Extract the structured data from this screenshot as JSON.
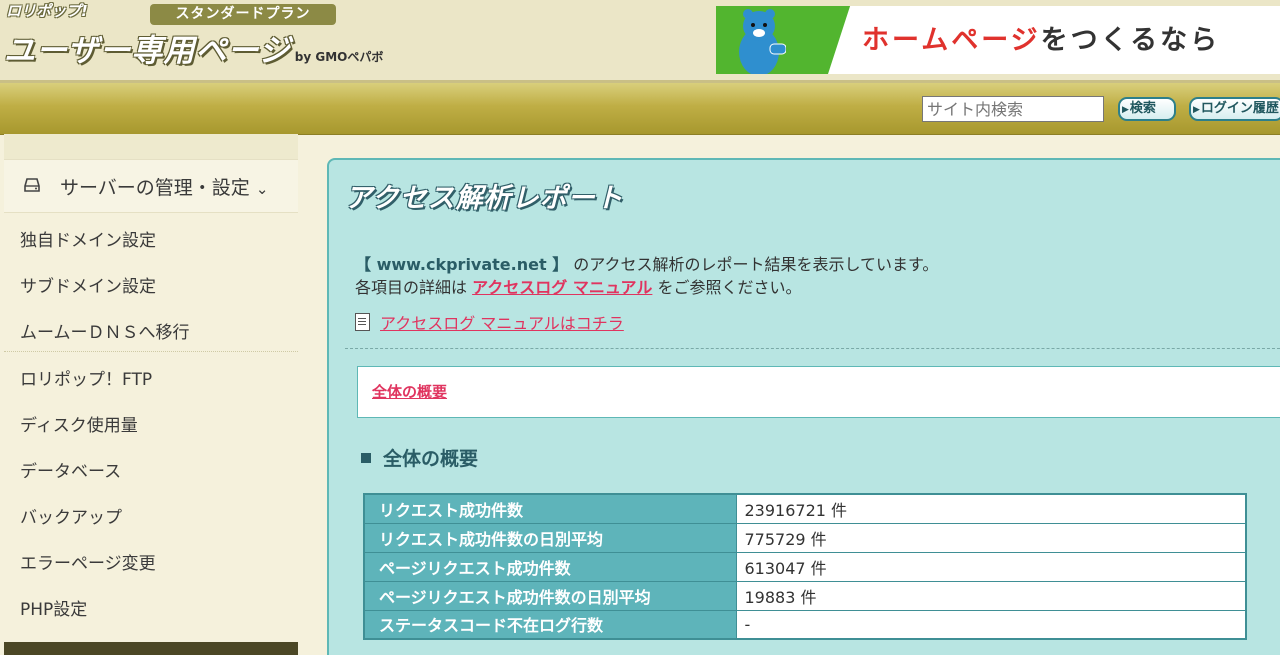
{
  "header": {
    "brand": "ロリポップ!",
    "plan": "スタンダードプラン",
    "title": "ユーザー専用ページ",
    "by": "by GMOペパボ",
    "banner": {
      "text_red1": "ホーム",
      "text_red2": "ページ",
      "text_dark": "をつくるなら"
    },
    "search": {
      "placeholder": "サイト内検索",
      "button": "検索"
    },
    "login_history": "ログイン履歴"
  },
  "sidebar": {
    "section": "サーバーの管理・設定",
    "items": [
      {
        "label": "独自ドメイン設定"
      },
      {
        "label": "サブドメイン設定"
      },
      {
        "label": "ムームーＤＮＳへ移行"
      },
      {
        "label": "ロリポップ！FTP"
      },
      {
        "label": "ディスク使用量"
      },
      {
        "label": "データベース"
      },
      {
        "label": "バックアップ"
      },
      {
        "label": "エラーページ変更"
      },
      {
        "label": "PHP設定"
      }
    ]
  },
  "main": {
    "title": "アクセス解析レポート",
    "intro": {
      "domain": "【 www.ckprivate.net 】",
      "line1_rest": " のアクセス解析のレポート結果を表示しています。",
      "line2_pre": "各項目の詳細は ",
      "line2_link": "アクセスログ マニュアル",
      "line2_post": " をご参照ください。"
    },
    "manual_link": "アクセスログ マニュアルはコチラ",
    "toc_link": "全体の概要",
    "section_heading": "全体の概要",
    "stats": [
      {
        "label": "リクエスト成功件数",
        "value": "23916721 件"
      },
      {
        "label": "リクエスト成功件数の日別平均",
        "value": "775729 件"
      },
      {
        "label": "ページリクエスト成功件数",
        "value": "613047 件"
      },
      {
        "label": "ページリクエスト成功件数の日別平均",
        "value": "19883 件"
      },
      {
        "label": "ステータスコード不在ログ行数",
        "value": "-"
      }
    ]
  },
  "colors": {
    "accent_teal": "#5eb4ba",
    "link_pink": "#e0345f",
    "gold": "#bfae45",
    "banner_green": "#52b52f"
  }
}
